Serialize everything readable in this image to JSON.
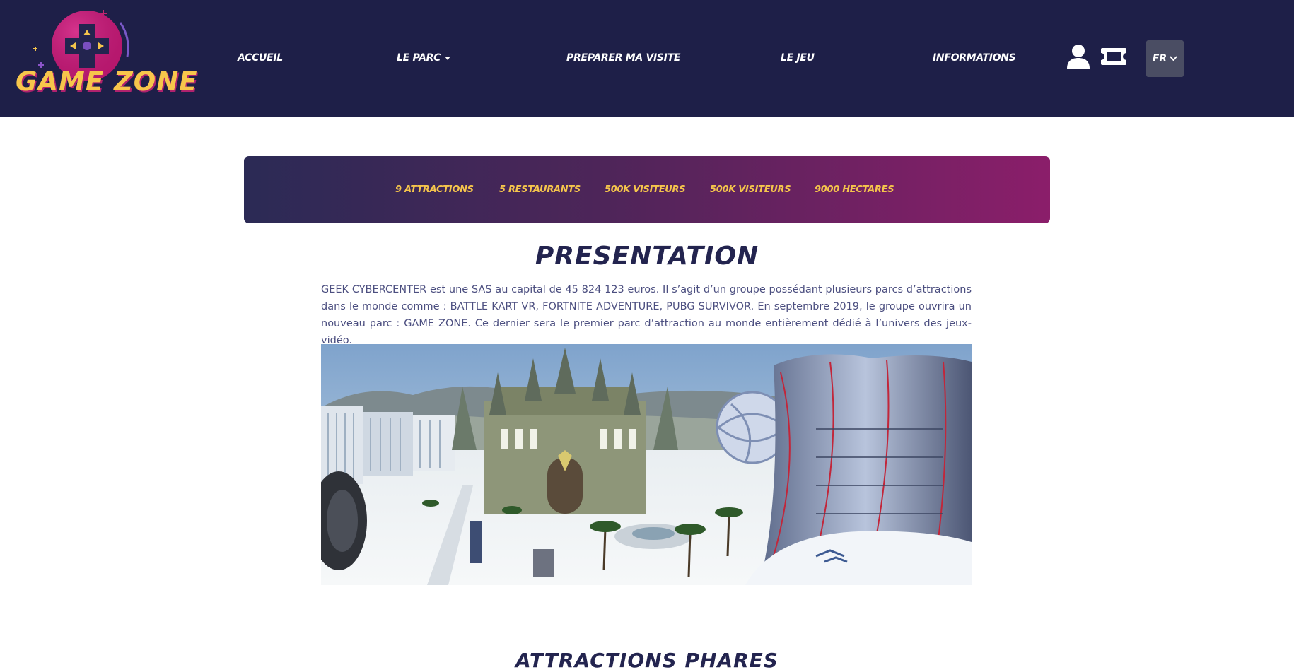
{
  "header": {
    "logo_text": "GAME ZONE",
    "nav": [
      {
        "label": "ACCUEIL"
      },
      {
        "label": "LE PARC"
      },
      {
        "label": "PREPARER MA VISITE"
      },
      {
        "label": "LE JEU"
      },
      {
        "label": "INFORMATIONS"
      }
    ],
    "icons": {
      "account": "user-icon",
      "tickets": "ticket-icon",
      "language_chevron": "chevron-down-icon"
    },
    "language": "FR"
  },
  "stats": [
    {
      "label": "9 ATTRACTIONS"
    },
    {
      "label": "5 RESTAURANTS"
    },
    {
      "label": "500K VISITEURS"
    },
    {
      "label": "500K VISITEURS"
    },
    {
      "label": "9000 HECTARES"
    }
  ],
  "presentation": {
    "title": "PRESENTATION",
    "text": "GEEK CYBERCENTER est une SAS au capital de 45 824 123 euros. Il s’agit d’un groupe possédant plusieurs parcs d’attractions dans le monde comme : BATTLE KART VR, FORTNITE ADVENTURE, PUBG SURVIVOR. En septembre 2019, le groupe ouvrira un nouveau parc : GAME ZONE. Ce dernier sera le premier parc d’attraction au monde entièrement dédié à l’univers des jeux-vidéo."
  },
  "attractions": {
    "title": "ATTRACTIONS PHARES"
  },
  "colors": {
    "header_bg": "#1e1f48",
    "accent_yellow": "#f5c54c",
    "accent_magenta": "#8b1e6a",
    "title_navy": "#23244f",
    "body_text": "#4c4f80",
    "lang_button_bg": "#4a4d63"
  }
}
